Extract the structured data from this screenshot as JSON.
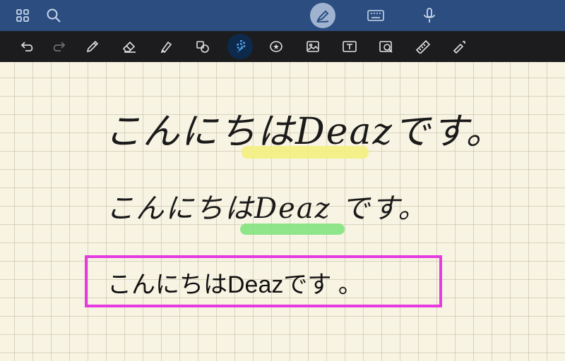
{
  "topbar": {
    "icons": [
      "grid-icon",
      "search-icon",
      "pen-mode-icon",
      "keyboard-icon",
      "microphone-icon"
    ]
  },
  "toolbar": {
    "icons": [
      "undo-icon",
      "redo-icon",
      "pen-icon",
      "eraser-icon",
      "highlighter-icon",
      "shapes-icon",
      "lasso-icon",
      "sticker-icon",
      "image-icon",
      "textbox-icon",
      "camera-icon",
      "ruler-icon",
      "laser-pointer-icon"
    ],
    "active": "lasso-icon"
  },
  "content": {
    "line1": {
      "text": "こんにちはDeazです。",
      "highlight": "Deaz",
      "highlight_color": "#f5f07a"
    },
    "line2": {
      "text": "こんにちはDeaz です。",
      "highlight": "Deaz",
      "highlight_color": "#7de37a"
    },
    "typed_text": "こんにちはDeazです 。",
    "selection_color": "#e63be0"
  }
}
